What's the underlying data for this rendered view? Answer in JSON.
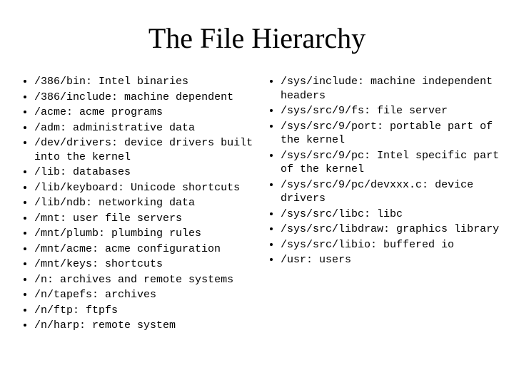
{
  "title": "The File Hierarchy",
  "left_items": [
    {
      "path": "/386/bin",
      "desc": "Intel binaries"
    },
    {
      "path": "/386/include",
      "desc": "machine dependent"
    },
    {
      "path": "/acme",
      "desc": "acme programs"
    },
    {
      "path": "/adm",
      "desc": "administrative data"
    },
    {
      "path": "/dev/drivers",
      "desc": "device drivers built into the kernel"
    },
    {
      "path": "/lib",
      "desc": "databases"
    },
    {
      "path": "/lib/keyboard",
      "desc": "Unicode shortcuts"
    },
    {
      "path": "/lib/ndb",
      "desc": "networking data"
    },
    {
      "path": "/mnt",
      "desc": "user file servers"
    },
    {
      "path": "/mnt/plumb",
      "desc": "plumbing rules"
    },
    {
      "path": "/mnt/acme",
      "desc": "acme configuration"
    },
    {
      "path": "/mnt/keys",
      "desc": "shortcuts"
    },
    {
      "path": "/n",
      "desc": "archives and remote systems"
    },
    {
      "path": "/n/tapefs",
      "desc": "archives"
    },
    {
      "path": "/n/ftp",
      "desc": "ftpfs"
    },
    {
      "path": "/n/harp",
      "desc": "remote system"
    }
  ],
  "right_items": [
    {
      "path": "/sys/include",
      "desc": "machine independent headers"
    },
    {
      "path": "/sys/src/9/fs",
      "desc": "file server"
    },
    {
      "path": "/sys/src/9/port",
      "desc": "portable part of the kernel"
    },
    {
      "path": "/sys/src/9/pc",
      "desc": "Intel specific part of the kernel"
    },
    {
      "path": "/sys/src/9/pc/devxxx.c",
      "desc": "device drivers"
    },
    {
      "path": "/sys/src/libc",
      "desc": "libc"
    },
    {
      "path": "/sys/src/libdraw",
      "desc": "graphics library"
    },
    {
      "path": "/sys/src/libio",
      "desc": "buffered io"
    },
    {
      "path": "/usr",
      "desc": "users"
    }
  ],
  "sep": ": "
}
